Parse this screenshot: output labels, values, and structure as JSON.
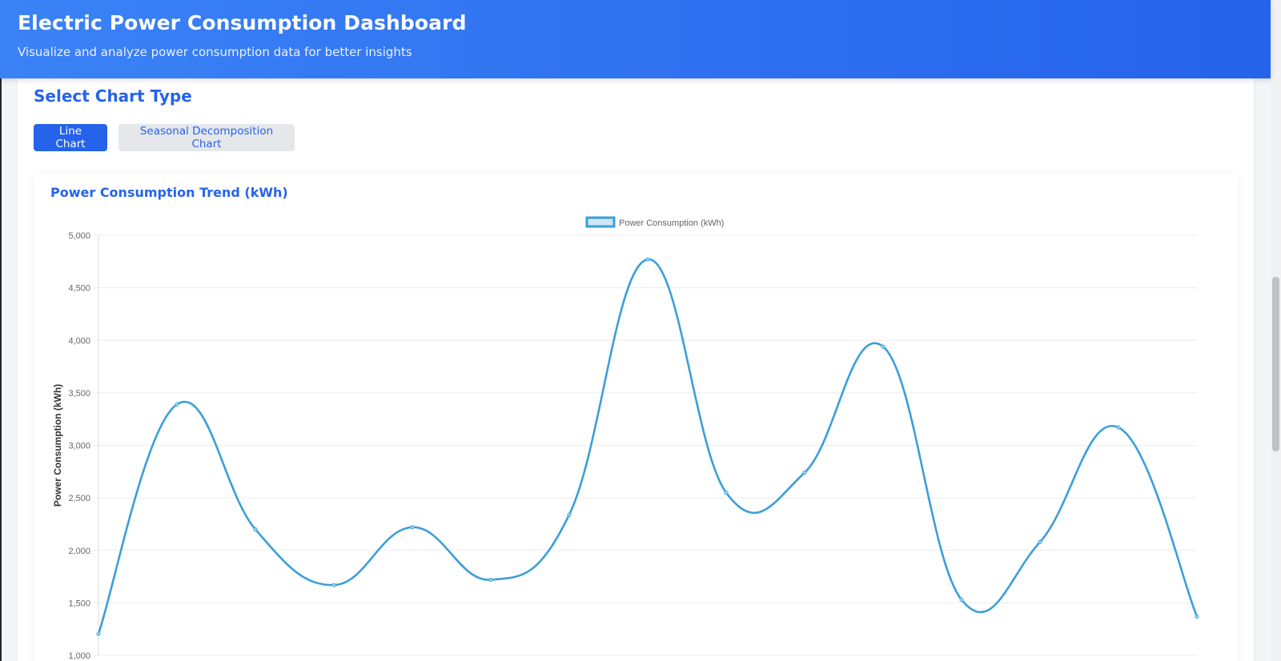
{
  "header": {
    "title": "Electric Power Consumption Dashboard",
    "subtitle": "Visualize and analyze power consumption data for better insights"
  },
  "controls": {
    "section_title": "Select Chart Type",
    "buttons": [
      {
        "label": "Line Chart",
        "active": true
      },
      {
        "label": "Seasonal Decomposition Chart",
        "active": false
      }
    ]
  },
  "chart_panel": {
    "title": "Power Consumption Trend (kWh)"
  },
  "chart_data": {
    "type": "line",
    "title": "",
    "xlabel": "",
    "ylabel": "Power Consumption (kWh)",
    "ylim": [
      1000,
      5000
    ],
    "yticks": [
      1000,
      1500,
      2000,
      2500,
      3000,
      3500,
      4000,
      4500,
      5000
    ],
    "ytick_labels": [
      "1,000",
      "1,500",
      "2,000",
      "2,500",
      "3,000",
      "3,500",
      "4,000",
      "4,500",
      "5,000"
    ],
    "grid": true,
    "legend": "top-center",
    "series": [
      {
        "name": "Power Consumption (kWh)",
        "values": [
          1205,
          3390,
          2200,
          1670,
          2220,
          1720,
          2340,
          4770,
          2550,
          2740,
          3940,
          1530,
          2080,
          3170,
          1370
        ]
      }
    ],
    "colors": {
      "line": "#3b9fd8",
      "fill": "#cde7f7",
      "grid": "#ececec"
    }
  }
}
